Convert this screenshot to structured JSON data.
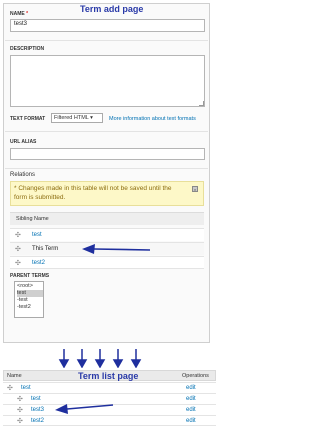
{
  "add_page": {
    "title": "Term add page",
    "name_label": "NAME",
    "name_required_mark": "*",
    "name_value": "test3",
    "description_label": "DESCRIPTION",
    "text_format_label": "TEXT FORMAT",
    "text_format_value": "Filtered HTML",
    "text_format_help": "More information about text formats",
    "url_alias_label": "URL ALIAS",
    "url_alias_value": "",
    "relations_label": "Relations",
    "warning": "* Changes made in this table will not be saved until the form is submitted.",
    "sibling_header": "Sibling Name",
    "siblings": [
      "test",
      "This Term",
      "test2"
    ],
    "parent_terms_label": "PARENT TERMS",
    "parent_options": [
      "<root>",
      "test",
      "-test",
      "-test2"
    ],
    "parent_selected": "test"
  },
  "list_page": {
    "title": "Term list page",
    "col_name": "Name",
    "col_operations": "Operations",
    "rows": [
      {
        "name": "test",
        "op": "edit"
      },
      {
        "name": "test",
        "op": "edit"
      },
      {
        "name": "test3",
        "op": "edit"
      },
      {
        "name": "test2",
        "op": "edit"
      }
    ]
  },
  "colors": {
    "link": "#0071b3",
    "title": "#2a3aa8",
    "arrow": "#1f2f9e",
    "warning_bg": "#fdf8c8"
  }
}
